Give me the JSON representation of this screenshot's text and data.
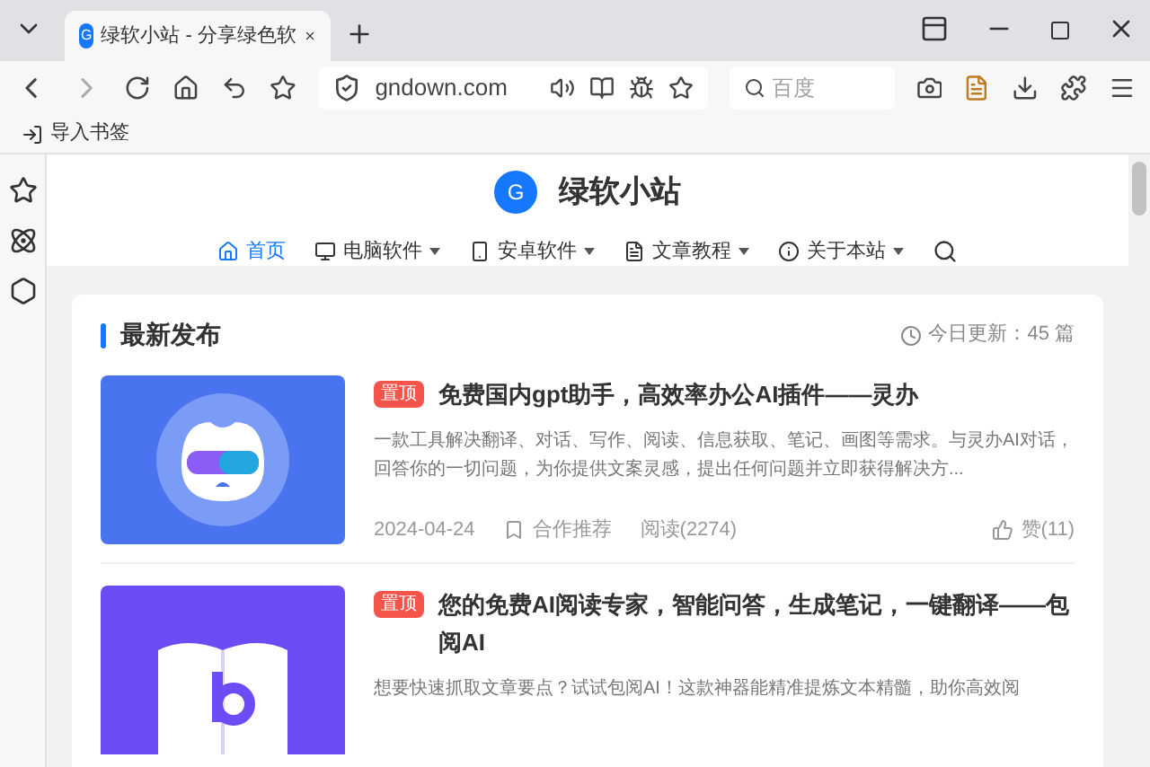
{
  "browser": {
    "tab": {
      "icon": "G",
      "title": "绿软小站 - 分享绿色软",
      "selected": true
    },
    "address": "gndown.com",
    "search": {
      "placeholder": "百度"
    },
    "bookmarks": [
      {
        "label": "导入书签"
      }
    ]
  },
  "site": {
    "logo": "G",
    "name": "绿软小站",
    "nav": [
      {
        "label": "首页",
        "selected": true,
        "dropdown": false,
        "kind": "home"
      },
      {
        "label": "电脑软件",
        "selected": false,
        "dropdown": true,
        "kind": "windows"
      },
      {
        "label": "安卓软件",
        "selected": false,
        "dropdown": true,
        "kind": "android"
      },
      {
        "label": "文章教程",
        "selected": false,
        "dropdown": true,
        "kind": "doc"
      },
      {
        "label": "关于本站",
        "selected": false,
        "dropdown": true,
        "kind": "info"
      }
    ],
    "section": {
      "title": "最新发布",
      "today": "今日更新：45 篇"
    },
    "articles": [
      {
        "kind": "mascot",
        "badge": "置顶",
        "title": "免费国内gpt助手，高效率办公AI插件——灵办",
        "desc": "一款工具解决翻译、对话、写作、阅读、信息获取、笔记、画图等需求。与灵办AI对话，回答你的一切问题，为你提供文案灵感，提出任何问题并立即获得解决方...",
        "date": "2024-04-24",
        "category": "合作推荐",
        "views": "阅读(2274)",
        "likes": "赞(11)"
      },
      {
        "kind": "book",
        "badge": "置顶",
        "title": "您的免费AI阅读专家，智能问答，生成笔记，一键翻译——包阅AI",
        "desc": "想要快速抓取文章要点？试试包阅AI！这款神器能精准提炼文本精髓，助你高效阅"
      }
    ]
  }
}
